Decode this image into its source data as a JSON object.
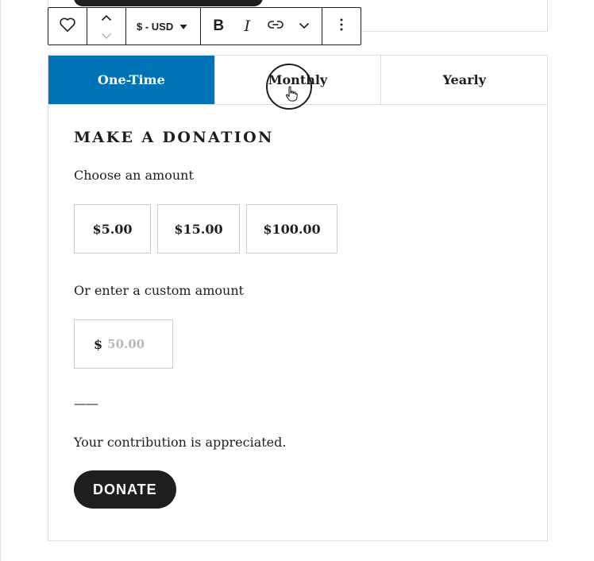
{
  "toolbar": {
    "currency_label": "$ - USD",
    "bold_label": "B",
    "italic_label": "I",
    "icons": {
      "block": "heart-icon",
      "move_up": "chevron-up-icon",
      "move_down": "chevron-down-icon",
      "currency_dropdown": "caret-down-icon",
      "link": "link-icon",
      "more_formats": "chevron-down-icon",
      "options": "vertical-ellipsis-icon"
    }
  },
  "donation": {
    "tabs": [
      {
        "label": "One-Time",
        "active": true
      },
      {
        "label": "Monthly",
        "active": false
      },
      {
        "label": "Yearly",
        "active": false
      }
    ],
    "heading": "MAKE A DONATION",
    "choose_label": "Choose an amount",
    "amounts": [
      "$5.00",
      "$15.00",
      "$100.00"
    ],
    "custom_label": "Or enter a custom amount",
    "custom_currency": "$",
    "custom_placeholder": "50.00",
    "separator": "——",
    "thanks": "Your contribution is appreciated.",
    "donate_label": "DONATE"
  },
  "colors": {
    "accent": "#0073b7",
    "text": "#1e1e1e",
    "border": "#dddddd",
    "button": "#1e1e1e"
  }
}
